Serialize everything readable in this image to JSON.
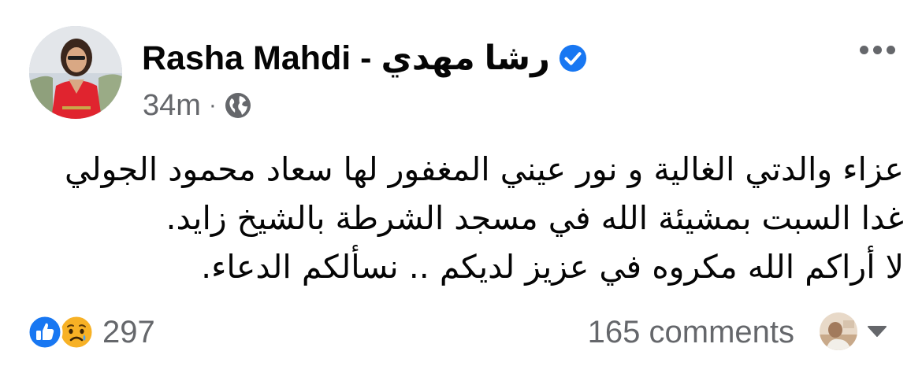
{
  "post": {
    "author_name": "Rasha Mahdi - رشا مهدي",
    "verified_icon": "verified-badge-icon",
    "timestamp": "34m",
    "separator": "·",
    "privacy_icon": "globe-icon",
    "more_icon": "more-options-icon",
    "body_lines": [
      "عزاء والدتي الغالية و نور عيني المغفور لها سعاد محمود الجولي",
      "غدا السبت بمشيئة الله في مسجد الشرطة بالشيخ زايد.",
      "لا أراكم الله مكروه في عزيز لديكم .. نسألكم الدعاء."
    ]
  },
  "footer": {
    "reaction_icons": [
      "like-reaction-icon",
      "sad-reaction-icon"
    ],
    "reaction_count": "297",
    "comments_label": "165 comments",
    "commenter_avatar_icon": "commenter-avatar",
    "dropdown_icon": "caret-down-icon"
  },
  "colors": {
    "text_primary": "#050505",
    "text_secondary": "#65676b",
    "verified_blue": "#1877f2",
    "like_blue": "#1877f2",
    "sad_yellow": "#f7b125"
  }
}
